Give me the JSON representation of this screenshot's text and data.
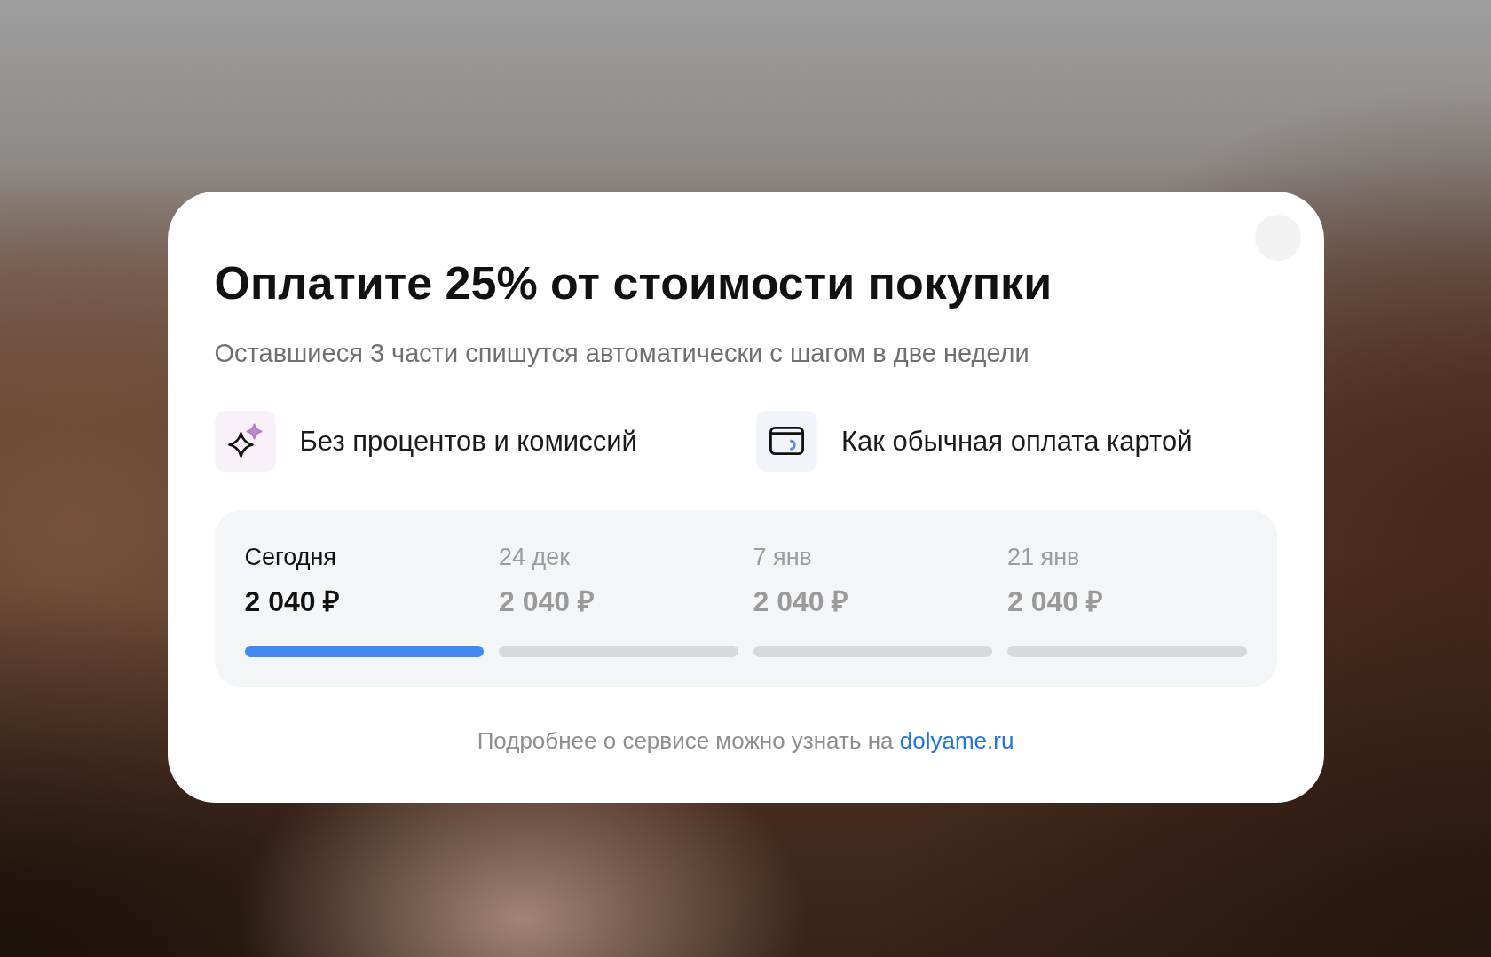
{
  "dialog": {
    "title": "Оплатите 25% от стоимости покупки",
    "subtitle": "Оставшиеся 3 части спишутся автоматически с шагом в две недели",
    "features": [
      {
        "kind": "sparkle",
        "label": "Без процентов и комиссий"
      },
      {
        "kind": "card",
        "label": "Как обычная оплата картой"
      }
    ],
    "schedule": [
      {
        "date": "Сегодня",
        "amount": "2 040 ₽",
        "selected": true
      },
      {
        "date": "24 дек",
        "amount": "2 040 ₽",
        "selected": false
      },
      {
        "date": "7 янв",
        "amount": "2 040 ₽",
        "selected": false
      },
      {
        "date": "21 янв",
        "amount": "2 040 ₽",
        "selected": false
      }
    ],
    "footer": {
      "text": "Подробнее о сервисе можно узнать на",
      "link": "dolyame.ru"
    }
  }
}
